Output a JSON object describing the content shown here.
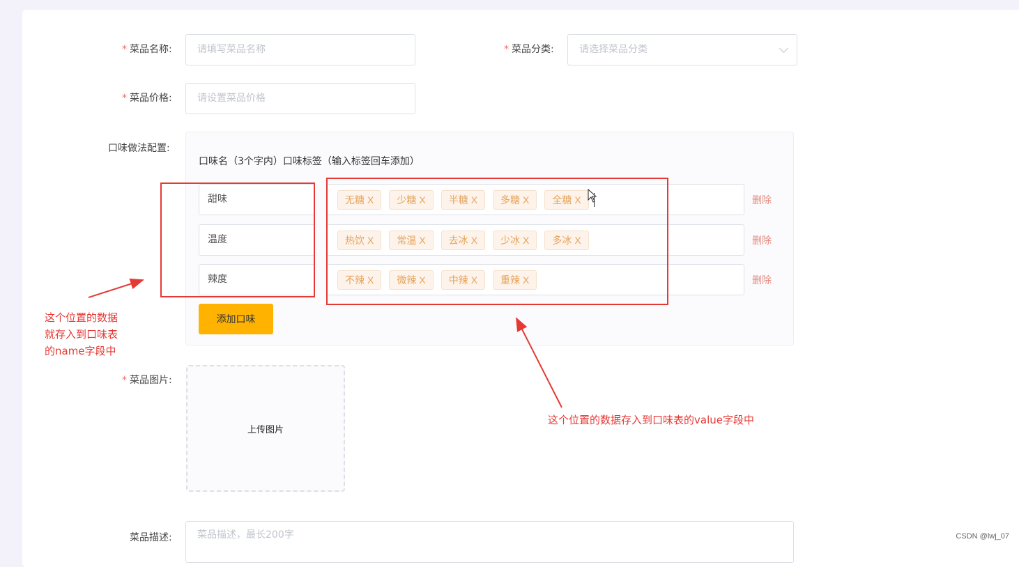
{
  "form": {
    "dish_name": {
      "label": "菜品名称:",
      "placeholder": "请填写菜品名称",
      "required": true
    },
    "category": {
      "label": "菜品分类:",
      "placeholder": "请选择菜品分类",
      "required": true
    },
    "price": {
      "label": "菜品价格:",
      "placeholder": "请设置菜品价格",
      "required": true
    },
    "flavor": {
      "label": "口味做法配置:",
      "header": "口味名（3个字内）口味标签（输入标签回车添加）",
      "rows": [
        {
          "name": "甜味",
          "tags": [
            "无糖",
            "少糖",
            "半糖",
            "多糖",
            "全糖"
          ],
          "delete_label": "删除"
        },
        {
          "name": "温度",
          "tags": [
            "热饮",
            "常温",
            "去冰",
            "少冰",
            "多冰"
          ],
          "delete_label": "删除"
        },
        {
          "name": "辣度",
          "tags": [
            "不辣",
            "微辣",
            "中辣",
            "重辣"
          ],
          "delete_label": "删除"
        }
      ],
      "tag_close": "X",
      "add_button": "添加口味"
    },
    "image": {
      "label": "菜品图片:",
      "upload_label": "上传图片",
      "required": true
    },
    "description": {
      "label": "菜品描述:",
      "placeholder": "菜品描述，最长200字"
    }
  },
  "annotations": {
    "left_note": [
      "这个位置的数据",
      "就存入到口味表",
      "的name字段中"
    ],
    "right_note": "这个位置的数据存入到口味表的value字段中",
    "color": "#e53935"
  },
  "watermark": "CSDN @lwj_07",
  "colors": {
    "accent": "#ffb300",
    "required": "#f56c6c",
    "tag_text": "#e5a45c",
    "delete": "#e38a7f"
  }
}
